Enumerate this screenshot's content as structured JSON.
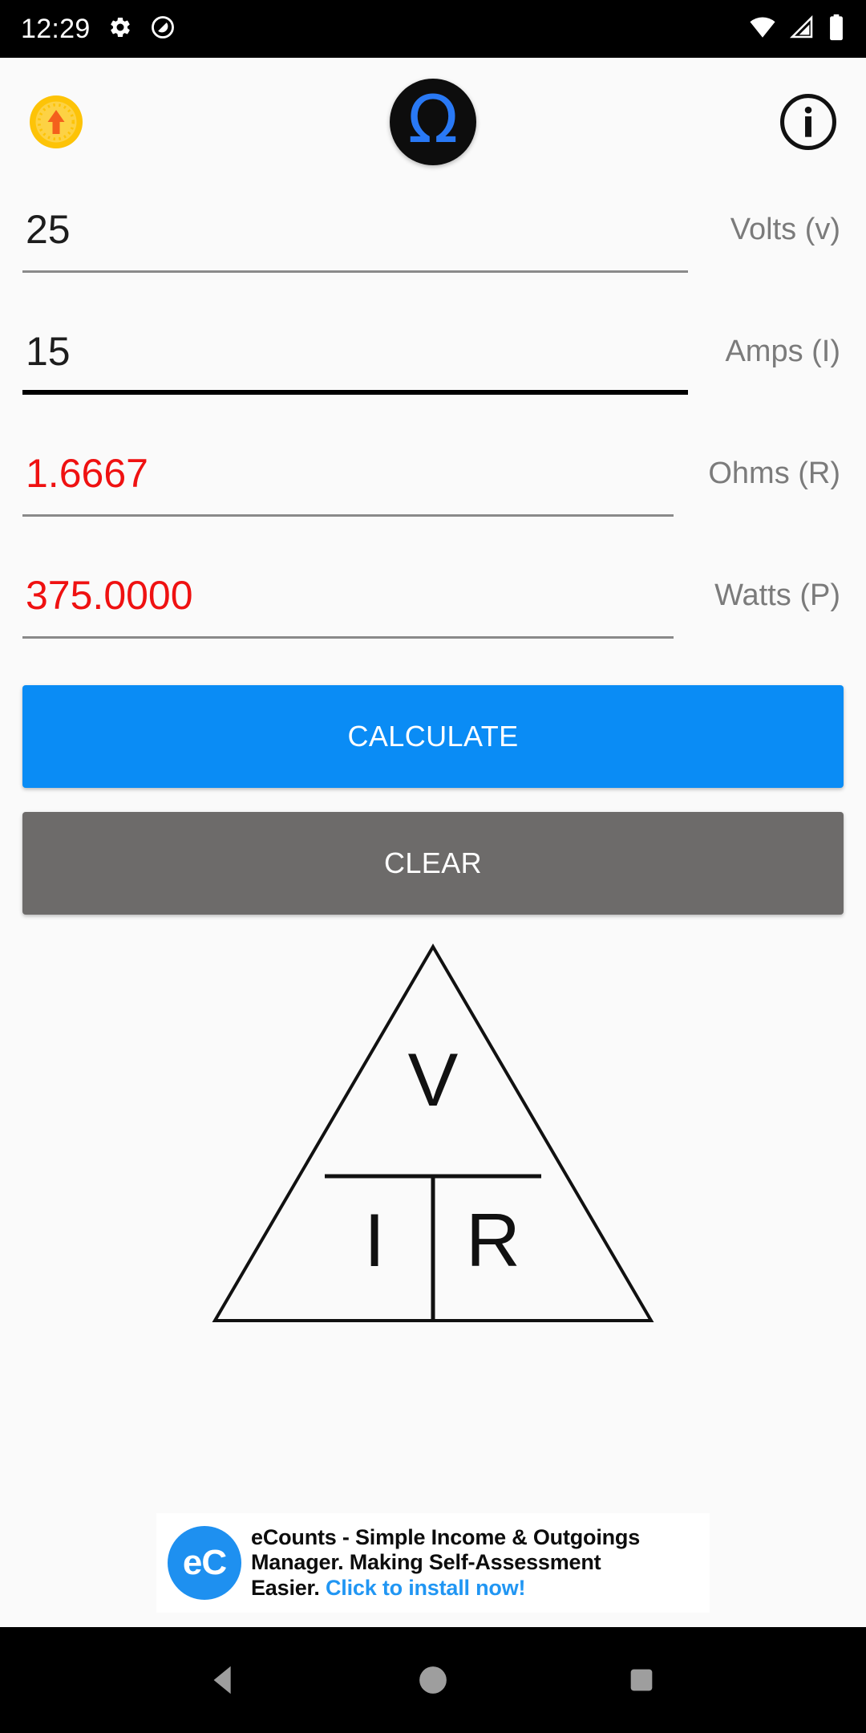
{
  "status_bar": {
    "time": "12:29",
    "left_icons": [
      "gear-icon",
      "do-not-disturb-icon"
    ],
    "right_icons": [
      "wifi-icon",
      "cellular-signal-icon",
      "battery-icon"
    ],
    "background_color": "#000000"
  },
  "app_header": {
    "upgrade_icon": "coin-upgrade-icon",
    "logo_symbol": "Ω",
    "logo_name": "omega-logo-icon",
    "logo_color": "#2979f5",
    "info_icon": "info-icon"
  },
  "fields": [
    {
      "name": "volts",
      "value": "25",
      "label": "Volts (v)",
      "is_result": false,
      "focused": false
    },
    {
      "name": "amps",
      "value": "15",
      "label": "Amps (I)",
      "is_result": false,
      "focused": true
    },
    {
      "name": "ohms",
      "value": "1.6667",
      "label": "Ohms (R)",
      "is_result": true,
      "focused": false
    },
    {
      "name": "watts",
      "value": "375.0000",
      "label": "Watts (P)",
      "is_result": true,
      "focused": false
    }
  ],
  "buttons": {
    "calculate_label": "CALCULATE",
    "calculate_color": "#0a8cf5",
    "clear_label": "CLEAR",
    "clear_color": "#6d6b6a"
  },
  "diagram": {
    "name": "ohms-law-triangle",
    "top_label": "V",
    "bottom_left_label": "I",
    "bottom_right_label": "R"
  },
  "ad": {
    "logo_text": "eC",
    "logo_color": "#1e90f0",
    "line1": "eCounts - Simple Income & Outgoings",
    "line2": "Manager. Making Self-Assessment",
    "line3_prefix": "Easier. ",
    "cta": "Click to install now!",
    "cta_color": "#2196f3"
  },
  "nav_bar": {
    "back_icon": "back-triangle-icon",
    "home_icon": "home-circle-icon",
    "recents_icon": "recents-square-icon",
    "glyph_color": "#9e9e9e"
  },
  "result_text_color": "#ef1111"
}
